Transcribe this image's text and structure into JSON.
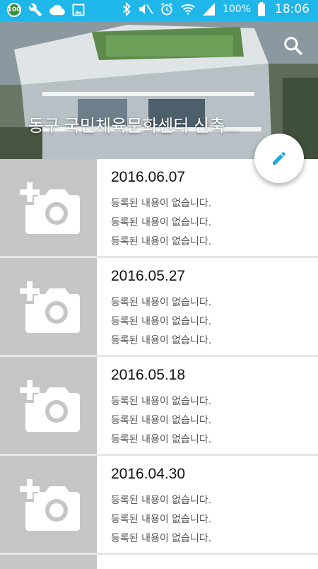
{
  "status_bar": {
    "battery_badge": "100",
    "battery_percent": "100%",
    "time": "18:06"
  },
  "header": {
    "title": "동구 국민체육문화센터 신축...",
    "search_icon": "search-icon"
  },
  "fab": {
    "icon": "pencil-icon",
    "color": "#1aa6e6"
  },
  "entries": [
    {
      "date": "2016.06.07",
      "lines": [
        "등록된 내용이 없습니다.",
        "등록된 내용이 없습니다.",
        "등록된 내용이 없습니다."
      ]
    },
    {
      "date": "2016.05.27",
      "lines": [
        "등록된 내용이 없습니다.",
        "등록된 내용이 없습니다.",
        "등록된 내용이 없습니다."
      ]
    },
    {
      "date": "2016.05.18",
      "lines": [
        "등록된 내용이 없습니다.",
        "등록된 내용이 없습니다.",
        "등록된 내용이 없습니다."
      ]
    },
    {
      "date": "2016.04.30",
      "lines": [
        "등록된 내용이 없습니다.",
        "등록된 내용이 없습니다.",
        "등록된 내용이 없습니다."
      ]
    }
  ],
  "colors": {
    "status_bar": "#1fb6ea",
    "thumb_bg": "#c5c5c5",
    "divider": "#e6e6e6"
  }
}
